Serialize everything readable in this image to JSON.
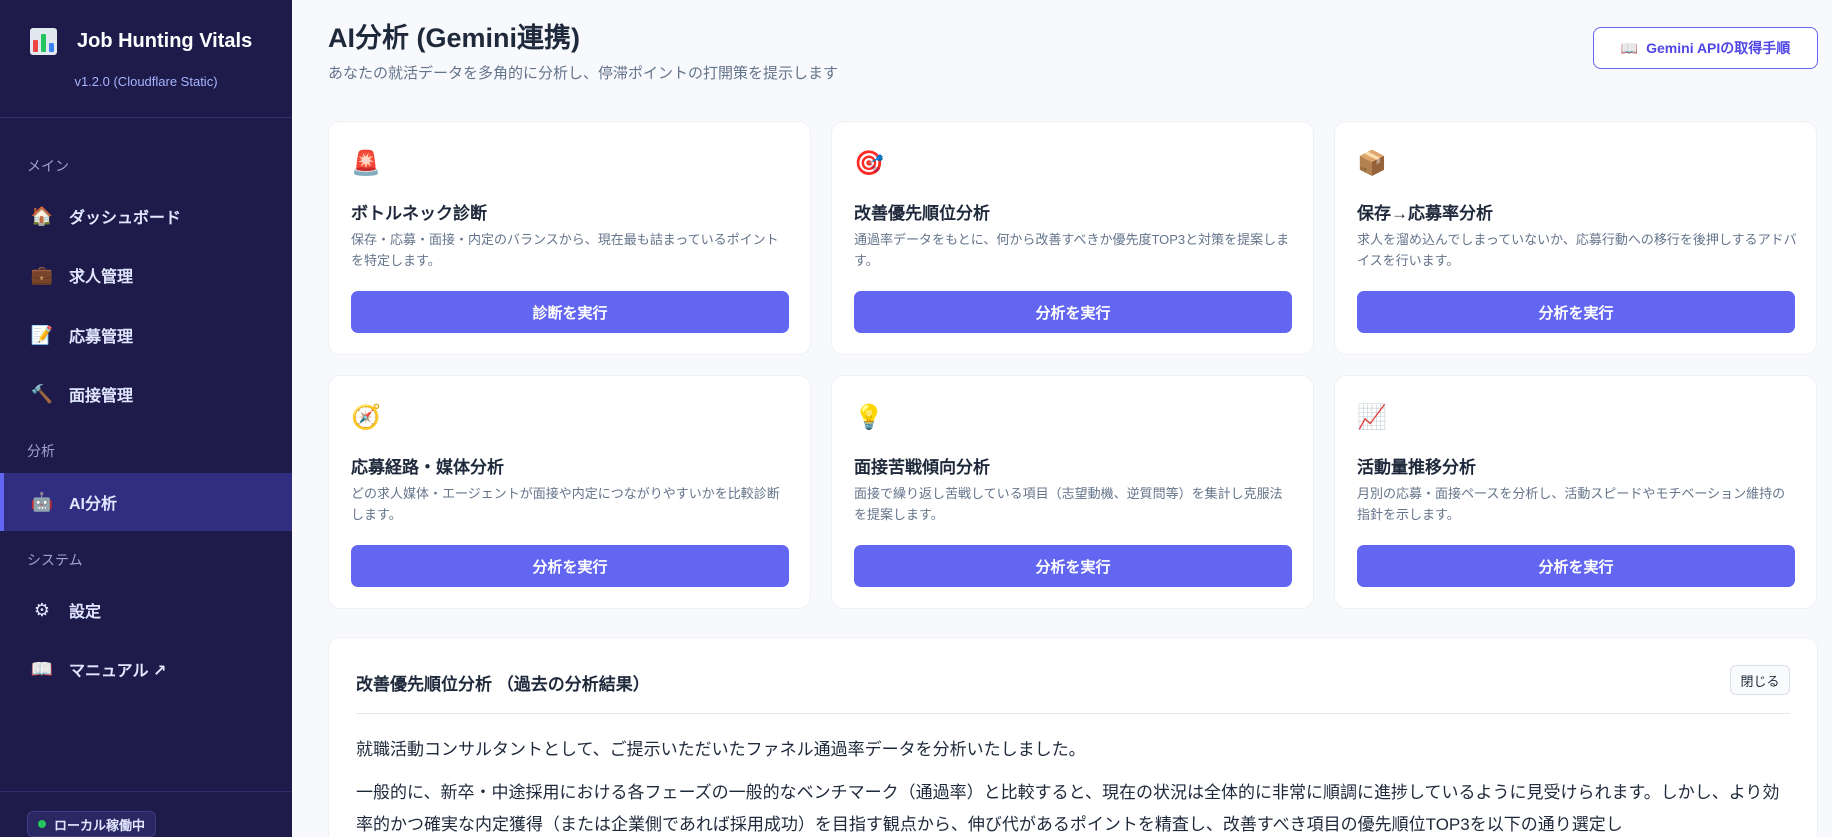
{
  "sidebar": {
    "brand_title": "Job Hunting Vitals",
    "version": "v1.2.0 (Cloudflare Static)",
    "sections": {
      "main": "メイン",
      "analysis": "分析",
      "system": "システム"
    },
    "items": [
      {
        "label": "ダッシュボード",
        "icon": "home-icon"
      },
      {
        "label": "求人管理",
        "icon": "briefcase-icon"
      },
      {
        "label": "応募管理",
        "icon": "document-icon"
      },
      {
        "label": "面接管理",
        "icon": "gavel-icon"
      },
      {
        "label": "AI分析",
        "icon": "robot-icon",
        "active": true
      },
      {
        "label": "設定",
        "icon": "gear-icon"
      },
      {
        "label": "マニュアル ↗",
        "icon": "book-icon"
      }
    ],
    "status": "ローカル稼働中"
  },
  "header": {
    "title": "AI分析 (Gemini連携)",
    "subtitle": "あなたの就活データを多角的に分析し、停滞ポイントの打開策を提示します",
    "guide_button": "Gemini APIの取得手順"
  },
  "cards": [
    {
      "icon": "siren-icon",
      "title": "ボトルネック診断",
      "desc": "保存・応募・面接・内定のバランスから、現在最も詰まっているポイントを特定します。",
      "button": "診断を実行"
    },
    {
      "icon": "target-icon",
      "title": "改善優先順位分析",
      "desc": "通過率データをもとに、何から改善すべきか優先度TOP3と対策を提案します。",
      "button": "分析を実行"
    },
    {
      "icon": "package-icon",
      "title": "保存→応募率分析",
      "desc": "求人を溜め込んでしまっていないか、応募行動への移行を後押しするアドバイスを行います。",
      "button": "分析を実行"
    },
    {
      "icon": "compass-icon",
      "title": "応募経路・媒体分析",
      "desc": "どの求人媒体・エージェントが面接や内定につながりやすいかを比較診断します。",
      "button": "分析を実行"
    },
    {
      "icon": "lightbulb-icon",
      "title": "面接苦戦傾向分析",
      "desc": "面接で繰り返し苦戦している項目（志望動機、逆質問等）を集計し克服法を提案します。",
      "button": "分析を実行"
    },
    {
      "icon": "chart-up-icon",
      "title": "活動量推移分析",
      "desc": "月別の応募・面接ペースを分析し、活動スピードやモチベーション維持の指針を示します。",
      "button": "分析を実行"
    }
  ],
  "result": {
    "title": "改善優先順位分析 （過去の分析結果）",
    "close_label": "閉じる",
    "paragraph1": "就職活動コンサルタントとして、ご提示いただいたファネル通過率データを分析いたしました。",
    "paragraph2": "一般的に、新卒・中途採用における各フェーズの一般的なベンチマーク（通過率）と比較すると、現在の状況は全体的に非常に順調に進捗しているように見受けられます。しかし、より効率的かつ確実な内定獲得（または企業側であれば採用成功）を目指す観点から、伸び代があるポイントを精査し、改善すべき項目の優先順位TOP3を以下の通り選定し"
  }
}
